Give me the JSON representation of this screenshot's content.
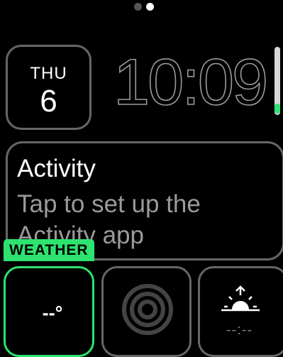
{
  "pager": {
    "count": 2,
    "active": 1
  },
  "date": {
    "weekday": "THU",
    "day": "6"
  },
  "time": {
    "display": "10:09"
  },
  "activity": {
    "title": "Activity",
    "description": "Tap to set up the Activity app"
  },
  "complications": {
    "weather_label": "WEATHER",
    "weather_temp": "--°",
    "sunrise_time": "--:--"
  },
  "colors": {
    "accent": "#2ee36f",
    "border": "#666666",
    "muted_text": "#9a9a9a"
  },
  "icons": {
    "rings": "activity-rings-icon",
    "sunrise": "sunrise-icon"
  }
}
